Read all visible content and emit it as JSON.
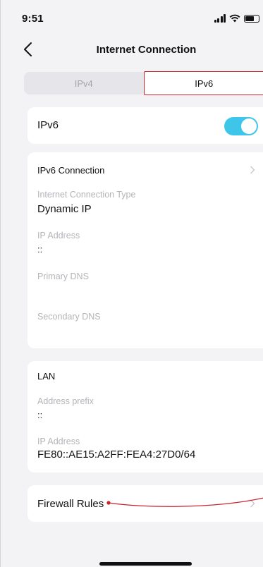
{
  "status_bar": {
    "time": "9:51"
  },
  "nav": {
    "title": "Internet Connection"
  },
  "tabs": [
    {
      "label": "IPv4",
      "active": false
    },
    {
      "label": "IPv6",
      "active": true
    }
  ],
  "ipv6_toggle": {
    "label": "IPv6",
    "on": true
  },
  "ipv6_connection": {
    "section_title": "IPv6 Connection",
    "fields": [
      {
        "label": "Internet Connection Type",
        "value": "Dynamic IP"
      },
      {
        "label": "IP Address",
        "value": "::"
      },
      {
        "label": "Primary DNS",
        "value": ""
      },
      {
        "label": "Secondary DNS",
        "value": ""
      }
    ]
  },
  "lan": {
    "section_title": "LAN",
    "fields": [
      {
        "label": "Address prefix",
        "value": "::"
      },
      {
        "label": "IP Address",
        "value": "FE80::AE15:A2FF:FEA4:27D0/64"
      }
    ]
  },
  "firewall": {
    "label": "Firewall Rules"
  },
  "colors": {
    "accent": "#3ec6ea",
    "highlight": "#c8232c",
    "background": "#f3f3f5"
  },
  "icons": [
    "back-chevron-icon",
    "chevron-right-icon",
    "signal-icon",
    "wifi-icon",
    "battery-icon"
  ]
}
